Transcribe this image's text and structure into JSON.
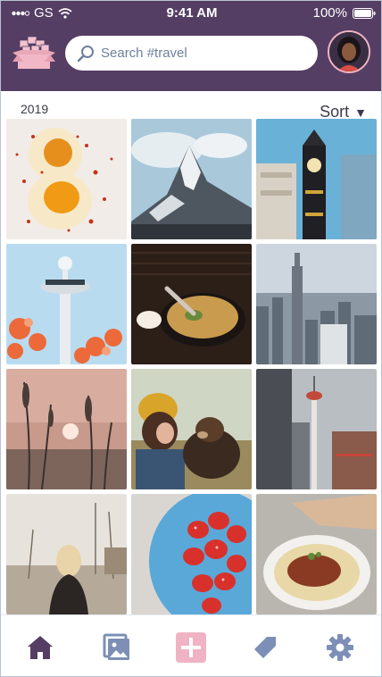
{
  "status_bar": {
    "carrier": "GS",
    "time": "9:41 AM",
    "battery": "100%"
  },
  "header": {
    "search": {
      "placeholder": "Search #travel",
      "icon": "search-icon"
    },
    "logo": "photo-boxes-logo",
    "avatar": "profile-avatar"
  },
  "gallery": {
    "year": "2019",
    "sort_label": "Sort",
    "photos": [
      "Soft boiled eggs with chili flakes",
      "Snowy mountain peak",
      "Clock tower among buildings",
      "Airport control tower with flowers",
      "Bowl of ramen",
      "City skyline with skyscraper",
      "Reeds at sunset",
      "Woman with dog in yellow hat",
      "City tower among buildings",
      "Woman walking at sunset",
      "Strawberries in blue bowl",
      "Plate of food on flatbread"
    ]
  },
  "bottom_nav": [
    {
      "name": "home",
      "icon": "home-icon",
      "active": true
    },
    {
      "name": "photos",
      "icon": "photos-icon",
      "active": false
    },
    {
      "name": "add",
      "icon": "add-icon",
      "active": false
    },
    {
      "name": "tags",
      "icon": "tag-icon",
      "active": false
    },
    {
      "name": "settings",
      "icon": "gear-icon",
      "active": false
    }
  ],
  "colors": {
    "header": "#553e64",
    "accent_pink": "#f0b3c3",
    "nav_active": "#553e64",
    "nav_inactive": "#7d8fb6"
  }
}
